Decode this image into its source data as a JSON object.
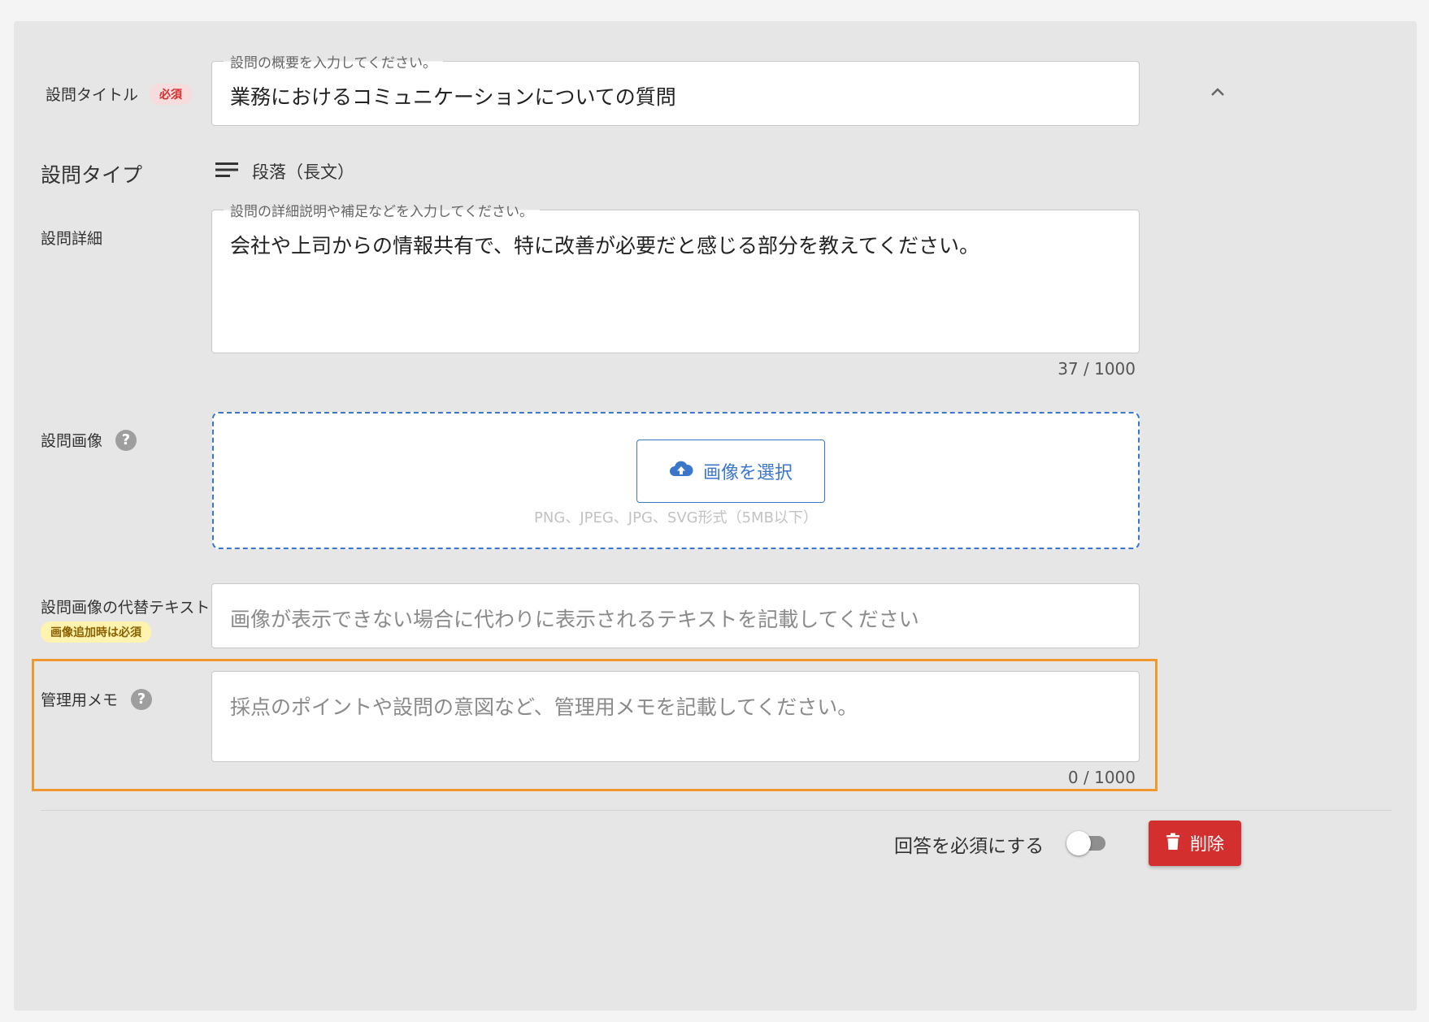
{
  "title_field": {
    "label": "設問タイトル",
    "required_badge": "必須",
    "floating_label": "設問の概要を入力してください。",
    "value": "業務におけるコミュニケーションについての質問"
  },
  "question_type": {
    "label": "設問タイプ",
    "value": "段落（長文）",
    "icon": "paragraph-icon"
  },
  "detail_field": {
    "label": "設問詳細",
    "floating_label": "設問の詳細説明や補足などを入力してください。",
    "value": "会社や上司からの情報共有で、特に改善が必要だと感じる部分を教えてください。",
    "counter": "37 / 1000"
  },
  "image_field": {
    "label": "設問画像",
    "help_icon": "help-icon",
    "upload_button": "画像を選択",
    "hint": "PNG、JPEG、JPG、SVG形式（5MB以下）"
  },
  "alt_text_field": {
    "label": "設問画像の代替テキスト",
    "badge": "画像追加時は必須",
    "placeholder": "画像が表示できない場合に代わりに表示されるテキストを記載してください"
  },
  "memo_field": {
    "label": "管理用メモ",
    "placeholder": "採点のポイントや設問の意図など、管理用メモを記載してください。",
    "counter": "0 / 1000"
  },
  "footer": {
    "required_toggle_label": "回答を必須にする",
    "required_toggle_on": false,
    "delete_button": "削除"
  },
  "colors": {
    "card_bg": "#e6e6e6",
    "accent_blue": "#3a76c9",
    "highlight_orange": "#f0972e",
    "danger_red": "#d32f2f"
  }
}
